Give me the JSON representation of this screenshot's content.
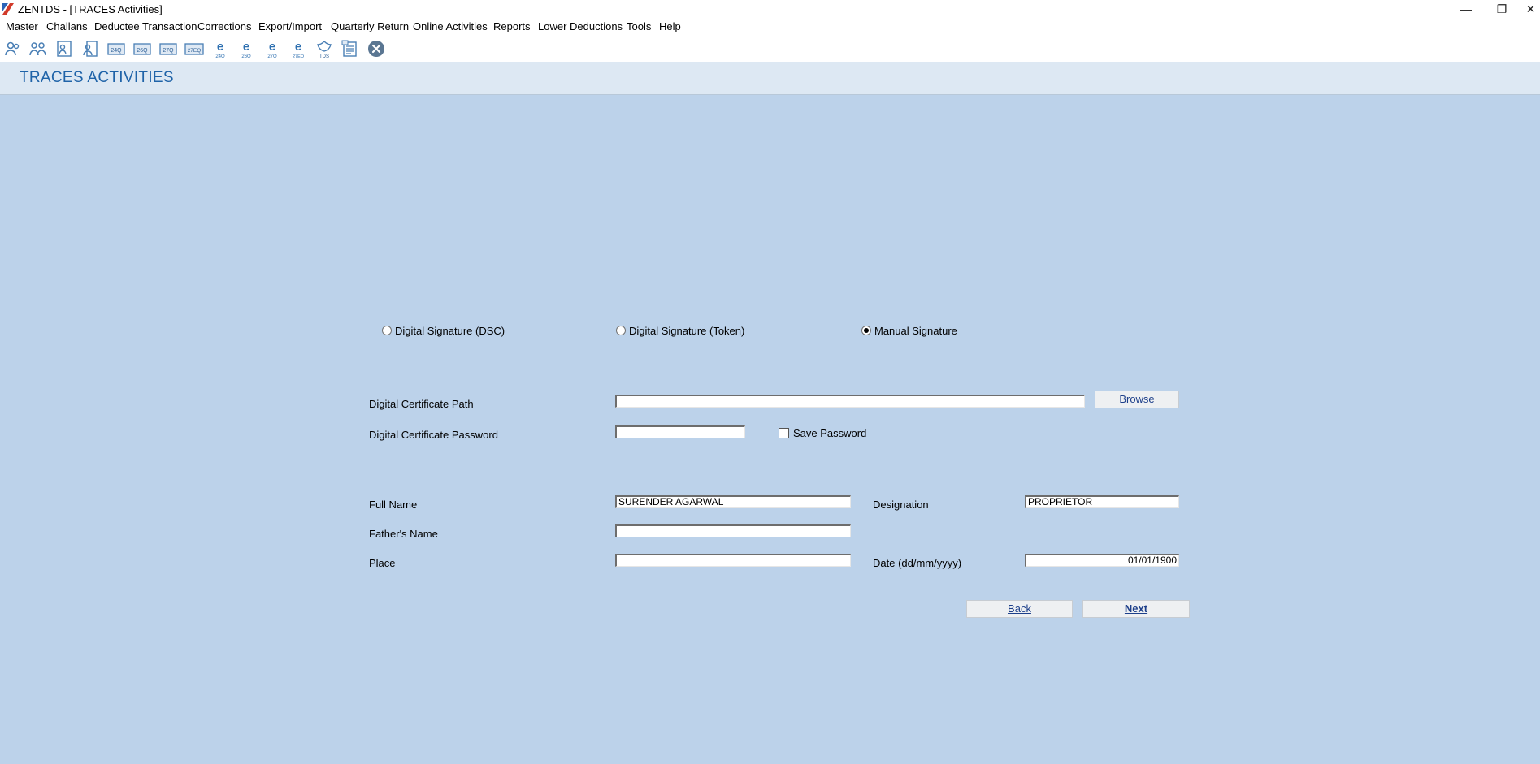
{
  "window": {
    "title": "ZENTDS - [TRACES Activities]",
    "minimize": "—",
    "restore": "❐",
    "close": "✕"
  },
  "menu": [
    "Master",
    "Challans",
    "Deductee Transaction",
    "Corrections",
    "Export/Import",
    "Quarterly Return",
    "Online Activities",
    "Reports",
    "Lower Deductions",
    "Tools",
    "Help"
  ],
  "toolbar_icons": [
    "deductor-icon",
    "deductees-icon",
    "employee-icon",
    "employee-alt-icon",
    "form-24q-icon",
    "form-26q-icon",
    "form-27q-icon",
    "form-27eq-icon",
    "e-24q-icon",
    "e-26q-icon",
    "e-27q-icon",
    "e-27eq-icon",
    "tds-logo-icon",
    "report-icon",
    "close-circle-icon"
  ],
  "header": {
    "title": "TRACES ACTIVITIES"
  },
  "signature": {
    "options": [
      "Digital Signature (DSC)",
      "Digital Signature (Token)",
      "Manual Signature"
    ],
    "selected": "Manual Signature"
  },
  "certificate": {
    "path_label": "Digital Certificate Path",
    "path_value": "",
    "browse_label": "Browse",
    "password_label": "Digital Certificate Password",
    "password_value": "",
    "save_password_label": "Save Password",
    "save_password_checked": false
  },
  "person": {
    "full_name_label": "Full Name",
    "full_name_value": "SURENDER AGARWAL",
    "designation_label": "Designation",
    "designation_value": "PROPRIETOR",
    "father_name_label": "Father's Name",
    "father_name_value": "",
    "place_label": "Place",
    "place_value": "",
    "date_label": "Date (dd/mm/yyyy)",
    "date_value": "01/01/1900"
  },
  "buttons": {
    "back": "Back",
    "next": "Next"
  },
  "colors": {
    "background": "#bcd2ea",
    "header_bg": "#dde8f3",
    "header_text": "#1f63a8",
    "button_text": "#1d3f8a"
  }
}
